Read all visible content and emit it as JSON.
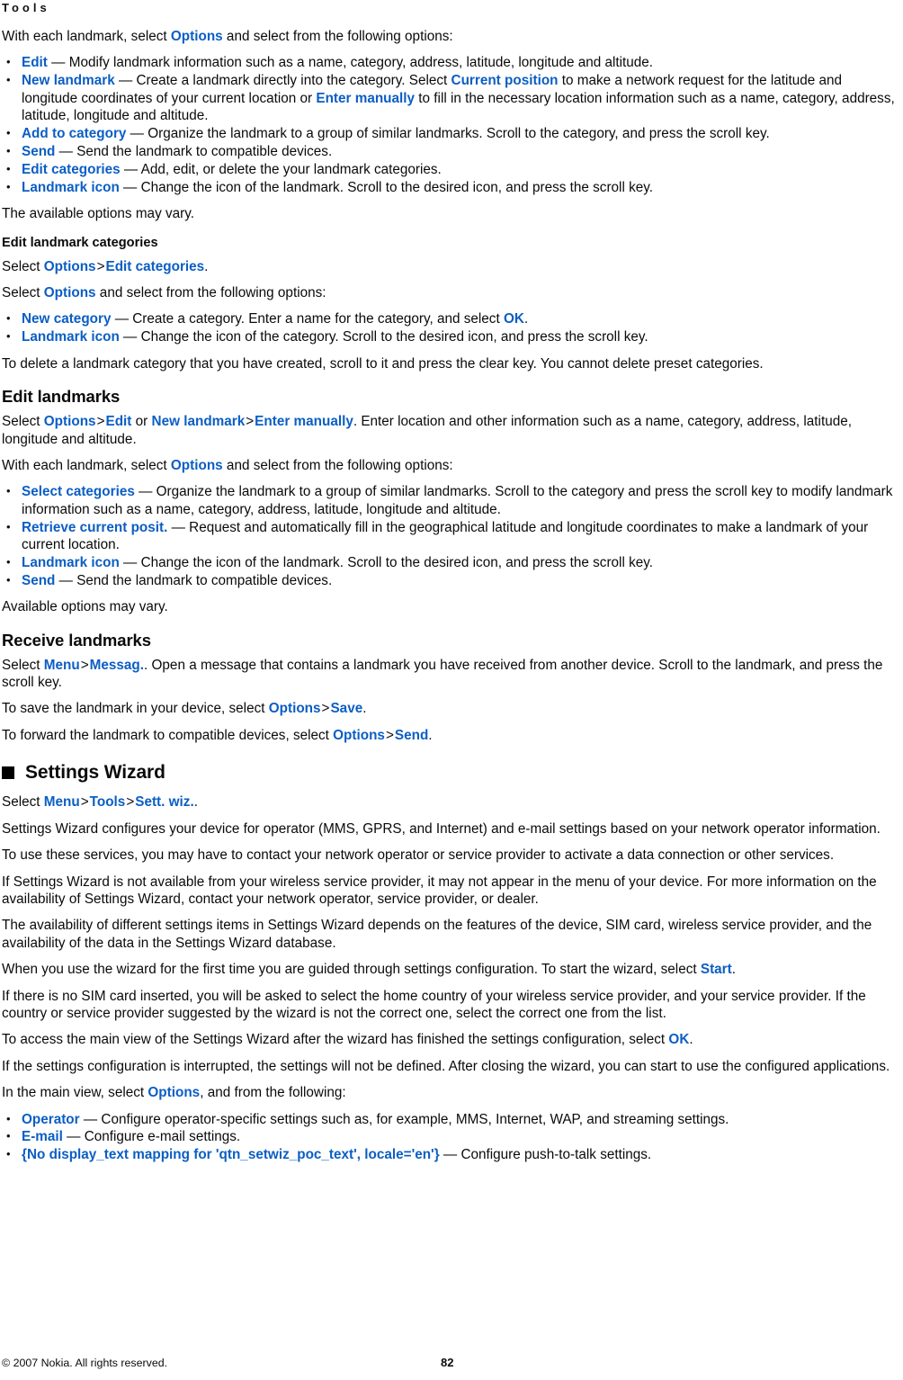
{
  "header": {
    "running_head": "Tools"
  },
  "colors": {
    "ui_reference_blue": "#0b5ec4",
    "body_text": "#0a0a0a",
    "page_background": "#ffffff"
  },
  "body": {
    "intro_para": {
      "pre": "With each landmark, select ",
      "ui1": "Options",
      "post": " and select from the following options:"
    },
    "landmark_options": [
      {
        "term": "Edit",
        "desc": " — Modify landmark information such as a name, category, address, latitude, longitude and altitude."
      },
      {
        "term": "New landmark",
        "desc_a": " — Create a landmark directly into the category. Select ",
        "ui_a": "Current position",
        "desc_b": " to make a network request for the latitude and longitude coordinates of your current location or ",
        "ui_b": "Enter manually",
        "desc_c": " to fill in the necessary location information such as a name, category, address, latitude, longitude and altitude."
      },
      {
        "term": "Add to category",
        "desc": " — Organize the landmark to a group of similar landmarks. Scroll to the category, and press the scroll key."
      },
      {
        "term": "Send",
        "desc": " — Send the landmark to compatible devices."
      },
      {
        "term": "Edit categories",
        "desc": " — Add, edit, or delete the your landmark categories."
      },
      {
        "term": "Landmark icon",
        "desc": " — Change the icon of the landmark. Scroll to the desired icon, and press the scroll key."
      }
    ],
    "options_may_vary": "The available options may vary.",
    "edit_landmark_categories": {
      "heading": "Edit landmark categories",
      "select_path": {
        "pre": "Select ",
        "ui1": "Options",
        "sep": ">",
        "ui2": "Edit categories",
        "post": "."
      },
      "select_intro": {
        "pre": "Select ",
        "ui1": "Options",
        "post": " and select from the following options:"
      },
      "options": [
        {
          "term": "New category",
          "desc_a": " — Create a category. Enter a name for the category, and select ",
          "ui_a": "OK",
          "desc_b": "."
        },
        {
          "term": "Landmark icon",
          "desc": " — Change the icon of the category. Scroll to the desired icon, and press the scroll key."
        }
      ],
      "delete_note": "To delete a landmark category that you have created, scroll to it and press the clear key. You cannot delete preset categories."
    },
    "edit_landmarks": {
      "heading": "Edit landmarks",
      "select_path": {
        "pre": "Select ",
        "ui1": "Options",
        "sep1": ">",
        "ui2": "Edit",
        "mid": " or ",
        "ui3": "New landmark",
        "sep2": ">",
        "ui4": "Enter manually",
        "post": ". Enter location and other information such as a name, category, address, latitude, longitude and altitude."
      },
      "with_each": {
        "pre": "With each landmark, select ",
        "ui1": "Options",
        "post": " and select from the following options:"
      },
      "options": [
        {
          "term": "Select categories",
          "desc": " — Organize the landmark to a group of similar landmarks. Scroll to the category and press the scroll key to modify landmark information such as a name, category, address, latitude, longitude and altitude."
        },
        {
          "term": "Retrieve current posit.",
          "desc": " — Request and automatically fill in the geographical latitude and longitude coordinates to make a landmark of your current location."
        },
        {
          "term": "Landmark icon",
          "desc": " — Change the icon of the landmark. Scroll to the desired icon, and press the scroll key."
        },
        {
          "term": "Send",
          "desc": " — Send the landmark to compatible devices."
        }
      ],
      "available_note": "Available options may vary."
    },
    "receive_landmarks": {
      "heading": "Receive landmarks",
      "select_path": {
        "pre": "Select ",
        "ui1": "Menu",
        "sep": ">",
        "ui2": "Messag.",
        "post": ". Open a message that contains a landmark you have received from another device. Scroll to the landmark, and press the scroll key."
      },
      "save_para": {
        "pre": "To save the landmark in your device, select ",
        "ui1": "Options",
        "sep": ">",
        "ui2": "Save",
        "post": "."
      },
      "forward_para": {
        "pre": "To forward the landmark to compatible devices, select ",
        "ui1": "Options",
        "sep": ">",
        "ui2": "Send",
        "post": "."
      }
    },
    "settings_wizard": {
      "heading": "Settings Wizard",
      "select_path": {
        "pre": "Select ",
        "ui1": "Menu",
        "sep1": ">",
        "ui2": "Tools",
        "sep2": ">",
        "ui3": "Sett. wiz.",
        "post": "."
      },
      "paragraphs": [
        "Settings Wizard configures your device for operator (MMS, GPRS, and Internet) and e-mail settings based on your network operator information.",
        "To use these services, you may have to contact your network operator or service provider to activate a data connection or other services.",
        "If Settings Wizard is not available from your wireless service provider, it may not appear in the menu of your device. For more information on the availability of Settings Wizard, contact your network operator, service provider, or dealer.",
        "The availability of different settings items in Settings Wizard depends on the features of the device, SIM card, wireless service provider, and the availability of the data in the Settings Wizard database."
      ],
      "first_time_para": {
        "pre": "When you use the wizard for the first time you are guided through settings configuration. To start the wizard, select ",
        "ui1": "Start",
        "post": "."
      },
      "no_sim_para": "If there is no SIM card inserted, you will be asked to select the home country of your wireless service provider, and your service provider. If the country or service provider suggested by the wizard is not the correct one, select the correct one from the list.",
      "main_view_para": {
        "pre": "To access the main view of the Settings Wizard after the wizard has finished the settings configuration, select ",
        "ui1": "OK",
        "post": "."
      },
      "interrupted_para": "If the settings configuration is interrupted, the settings will not be defined. After closing the wizard, you can start to use the configured applications.",
      "main_view_intro": {
        "pre": "In the main view, select ",
        "ui1": "Options",
        "post": ", and from the following:"
      },
      "options": [
        {
          "term": "Operator",
          "desc": " — Configure operator-specific settings such as, for example, MMS, Internet, WAP, and streaming settings."
        },
        {
          "term": "E-mail",
          "desc": " — Configure e-mail settings."
        },
        {
          "term": "{No display_text mapping for 'qtn_setwiz_poc_text', locale='en'}",
          "desc": " — Configure push-to-talk settings."
        }
      ]
    }
  },
  "footer": {
    "copyright": "© 2007 Nokia. All rights reserved.",
    "page_number": "82"
  }
}
